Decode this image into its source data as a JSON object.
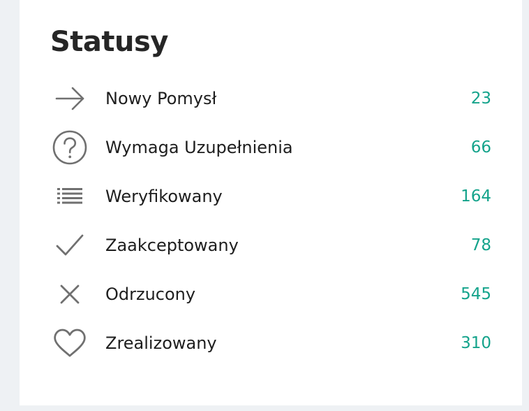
{
  "panel": {
    "title": "Statusy",
    "accent_color": "#14a38b",
    "icon_color": "#707070",
    "items": [
      {
        "label": "Nowy Pomysł",
        "count": "23",
        "icon": "arrow-right-icon"
      },
      {
        "label": "Wymaga Uzupełnienia",
        "count": "66",
        "icon": "question-circle-icon"
      },
      {
        "label": "Weryfikowany",
        "count": "164",
        "icon": "list-icon"
      },
      {
        "label": "Zaakceptowany",
        "count": "78",
        "icon": "check-icon"
      },
      {
        "label": "Odrzucony",
        "count": "545",
        "icon": "close-icon"
      },
      {
        "label": "Zrealizowany",
        "count": "310",
        "icon": "heart-icon"
      }
    ]
  }
}
